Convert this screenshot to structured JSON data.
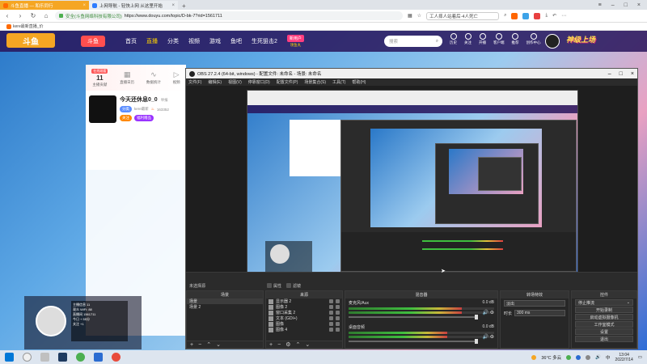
{
  "browser": {
    "tabs": [
      {
        "label": "斗鱼直播 — 和乐同行",
        "active": true
      },
      {
        "label": "上网导航 - 轻快上网 从这里开始",
        "active": false
      }
    ],
    "new_tab": "+",
    "url_prefix": "安全(斗鱼网络科技有限公司)",
    "url": "https://www.douyu.com/topic/D-bk-7?rid=1561711",
    "search_text": "工人摔人站着后·4人死亡",
    "bookmark": "kere最新直播_价"
  },
  "site": {
    "logo": "斗鱼",
    "logo2": "斗鱼",
    "nav": [
      "首页",
      "直播",
      "分类",
      "视频",
      "游戏",
      "鱼吧",
      "生死狙击2"
    ],
    "highlight_nav": "直播",
    "vip_badge": "新用户",
    "vip_sub": "领鱼丸",
    "search_placeholder": "搜索",
    "top_icons": [
      "历史",
      "关注",
      "开播",
      "客户端",
      "推荐",
      "创作中心"
    ],
    "banner": "神级上场"
  },
  "streamer": {
    "stats": [
      {
        "tag": "在线观看",
        "value": "11",
        "label": "主播贡献"
      },
      {
        "tag": "",
        "value": "",
        "label": "直播日历"
      },
      {
        "tag": "",
        "value": "",
        "label": "数据统计"
      },
      {
        "tag": "",
        "value": "",
        "label": "视频"
      }
    ],
    "name": "今天还休息0_0",
    "report": "举报",
    "category": "分类",
    "room": "kere最新",
    "hot": "163352",
    "follow": "关注",
    "fans_badge": "粉丝团",
    "gift_badge": "福利赠品"
  },
  "webcam": {
    "lines": [
      "主播信息 11",
      "观众 WiFi: 88",
      "直播间 1561711",
      "今日 + 55分",
      "关注 +1"
    ]
  },
  "obs": {
    "title": "OBS 27.2.4 (64-bit, windows) - 配置文件: 未命名 - 场景: 未命名",
    "menu": [
      "文件(F)",
      "编辑(E)",
      "视图(V)",
      "停靠窗口(D)",
      "配置文件(P)",
      "场景集合(S)",
      "工具(T)",
      "帮助(H)"
    ],
    "status": "未选择源",
    "preview_buttons": [
      "属性",
      "滤镜"
    ],
    "docks": {
      "scenes_head": "场景",
      "scenes": [
        "场景",
        "场景 2"
      ],
      "sources_head": "来源",
      "sources": [
        "显示器 2",
        "图像 2",
        "窗口采集 2",
        "文本 (GDI+)",
        "图像",
        "图像 4"
      ],
      "mixer_head": "混音器",
      "mixer": [
        {
          "name": "麦克风/Aux",
          "db": "0.0 dB",
          "level": 0.78
        },
        {
          "name": "桌面音频",
          "db": "0.0 dB",
          "level": 0.68
        }
      ],
      "transitions_head": "转场特效",
      "transition": "淡出",
      "duration_label": "时长",
      "duration": "300 ms",
      "controls_head": "控件",
      "controls": [
        "停止推流",
        "开始录制",
        "启动虚拟摄像机",
        "工作室模式",
        "设置",
        "退出"
      ]
    }
  },
  "taskbar": {
    "weather": "36°C 多云",
    "time": "13:04",
    "date": "2022/7/14",
    "lang": "中"
  }
}
